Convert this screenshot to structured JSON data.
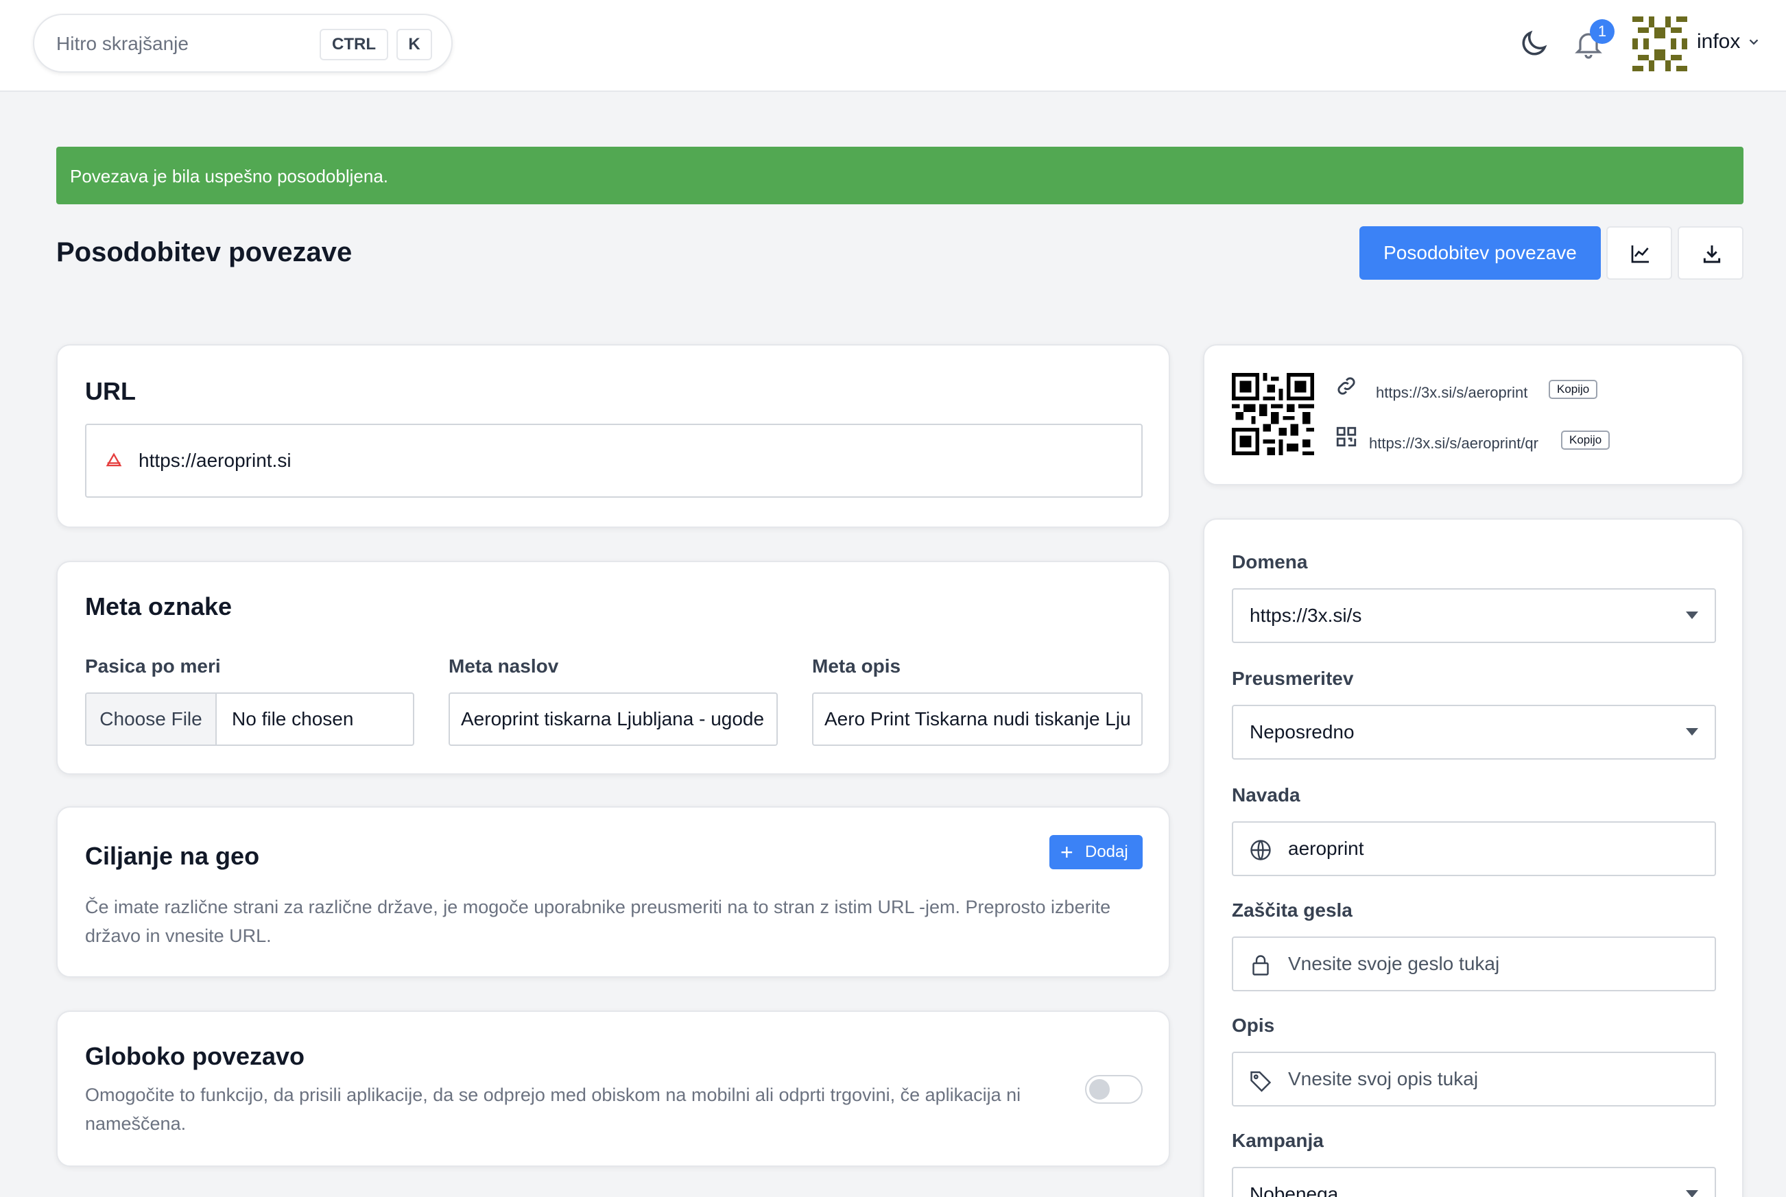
{
  "header": {
    "search_placeholder": "Hitro skrajšanje",
    "shortcut_ctrl": "CTRL",
    "shortcut_k": "K",
    "notification_count": "1",
    "username": "infox"
  },
  "alert": {
    "message": "Povezava je bila uspešno posodobljena."
  },
  "page": {
    "title": "Posodobitev povezave",
    "primary_button": "Posodobitev povezave"
  },
  "url_card": {
    "title": "URL",
    "url_value": "https://aeroprint.si"
  },
  "meta_card": {
    "title": "Meta oznake",
    "favicon_label": "Pasica po meri",
    "file_button": "Choose File",
    "file_status": "No file chosen",
    "meta_title_label": "Meta naslov",
    "meta_title_value": "Aeroprint tiskarna Ljubljana - ugode",
    "meta_desc_label": "Meta opis",
    "meta_desc_value": "Aero Print Tiskarna nudi tiskanje Lju"
  },
  "geo_card": {
    "title": "Ciljanje na geo",
    "add_button": "Dodaj",
    "description": "Če imate različne strani za različne države, je mogoče uporabnike preusmeriti na to stran z istim URL -jem. Preprosto izberite državo in vnesite URL."
  },
  "deep_card": {
    "title": "Globoko povezavo",
    "description": "Omogočite to funkcijo, da prisili aplikacije, da se odprejo med obiskom na mobilni ali odprti trgovini, če aplikacija ni nameščena.",
    "enabled": false
  },
  "qr_card": {
    "short_link": "https://3x.si/s/aeroprint",
    "qr_link": "https://3x.si/s/aeroprint/qr",
    "copy_label": "Kopijo"
  },
  "settings": {
    "domain_label": "Domena",
    "domain_value": "https://3x.si/s",
    "redirect_label": "Preusmeritev",
    "redirect_value": "Neposredno",
    "alias_label": "Navada",
    "alias_value": "aeroprint",
    "password_label": "Zaščita gesla",
    "password_placeholder": "Vnesite svoje geslo tukaj",
    "description_label": "Opis",
    "description_placeholder": "Vnesite svoj opis tukaj",
    "campaign_label": "Kampanja",
    "campaign_value": "Nobenega"
  },
  "icons": {
    "moon": "moon-icon",
    "bell": "bell-icon",
    "chart": "chart-icon",
    "download": "download-icon",
    "link": "link-icon",
    "qr": "qr-icon",
    "globe": "globe-icon",
    "lock": "lock-icon",
    "tag": "tag-icon"
  },
  "colors": {
    "primary": "#3b82f6",
    "success": "#52a852"
  }
}
